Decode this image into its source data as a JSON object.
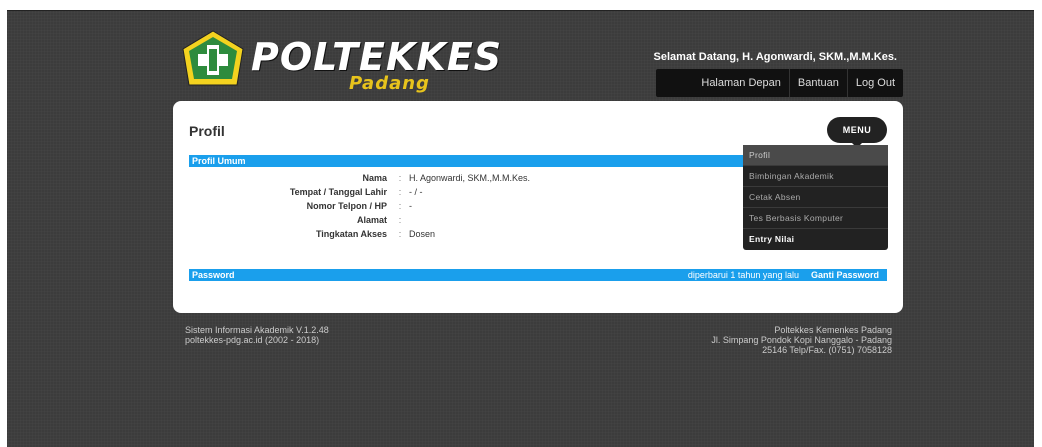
{
  "header": {
    "logo_text": "POLTEKKES",
    "logo_subtext": "Padang",
    "welcome": "Selamat Datang, H. Agonwardi, SKM.,M.M.Kes.",
    "nav": [
      "Halaman Depan",
      "Bantuan",
      "Log Out"
    ]
  },
  "page": {
    "title": "Profil",
    "menu_button": "MENU",
    "section_profil": "Profil Umum",
    "fields": [
      {
        "label": "Nama",
        "value": "H. Agonwardi, SKM.,M.M.Kes."
      },
      {
        "label": "Tempat / Tanggal Lahir",
        "value": "- / -"
      },
      {
        "label": "Nomor Telpon / HP",
        "value": "-"
      },
      {
        "label": "Alamat",
        "value": ""
      },
      {
        "label": "Tingkatan Akses",
        "value": "Dosen"
      }
    ],
    "password_bar": {
      "label": "Password",
      "updated": "diperbarui 1 tahun yang lalu",
      "change_link": "Ganti Password"
    }
  },
  "menu_items": [
    "Profil",
    "Bimbingan Akademik",
    "Cetak Absen",
    "Tes Berbasis Komputer",
    "Entry Nilai"
  ],
  "footer": {
    "left": [
      "Sistem Informasi Akademik V.1.2.48",
      "poltekkes-pdg.ac.id (2002 - 2018)"
    ],
    "right": [
      "Poltekkes Kemenkes Padang",
      "Jl. Simpang Pondok Kopi Nanggalo - Padang",
      "25146 Telp/Fax. (0751) 7058128"
    ]
  },
  "colors": {
    "accent": "#1a9fec",
    "dark": "#222222",
    "logo_yellow": "#e8c41c",
    "logo_green": "#2e8b3d"
  }
}
